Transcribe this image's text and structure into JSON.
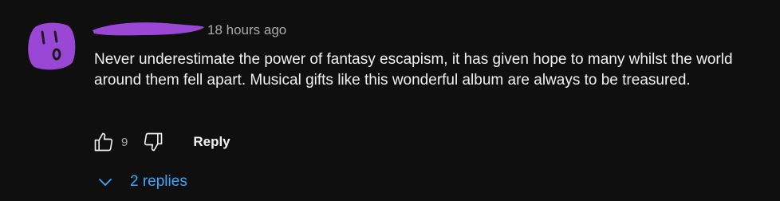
{
  "comment": {
    "author_obscured": true,
    "timestamp": "18 hours ago",
    "text": "Never underestimate the power of fantasy escapism, it has given hope to many whilst the world around them fell apart. Musical gifts like this wonderful album are always to be treasured.",
    "like_count": "9",
    "reply_label": "Reply",
    "replies_label": "2 replies"
  },
  "colors": {
    "background": "#0f0f0f",
    "text": "#f1f1f1",
    "secondary_text": "#aaaaaa",
    "link_blue": "#3ea6ff",
    "scribble_purple": "#9b47d6"
  },
  "icons": {
    "like": "thumbs-up-icon",
    "dislike": "thumbs-down-icon",
    "expand": "chevron-down-icon"
  }
}
